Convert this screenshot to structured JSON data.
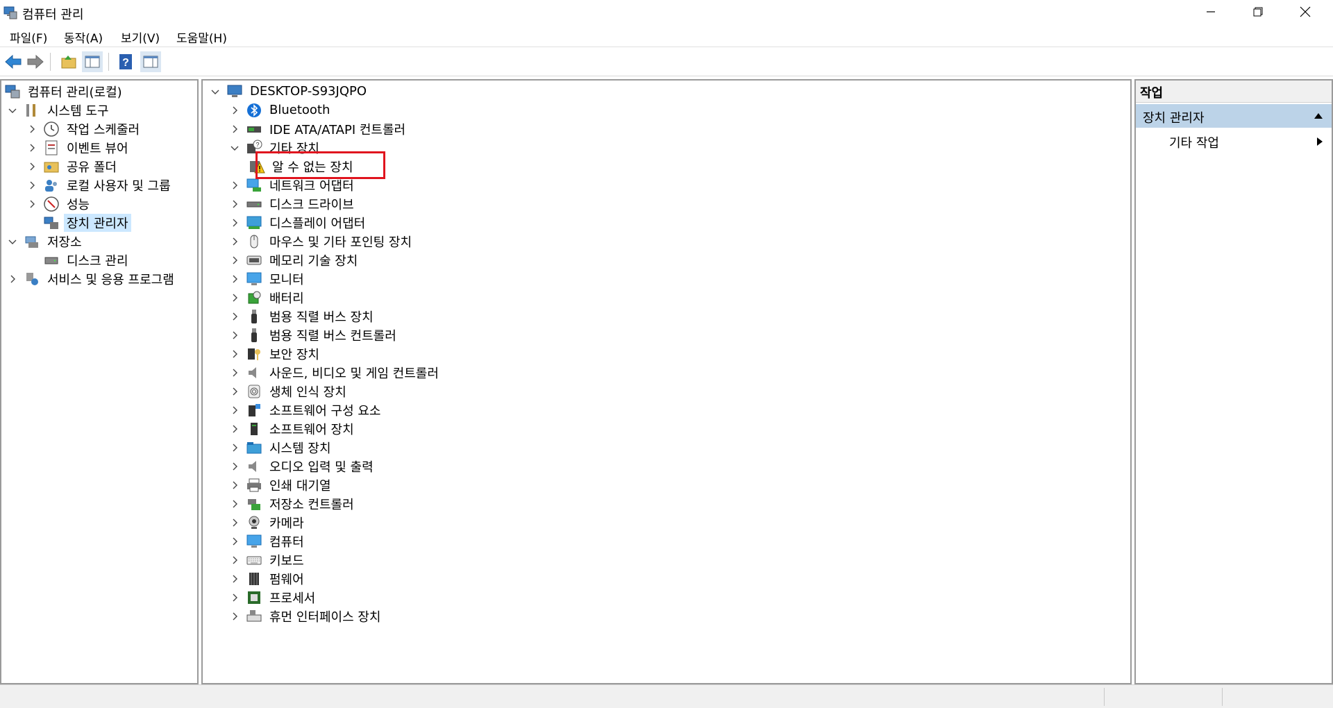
{
  "window": {
    "title": "컴퓨터 관리"
  },
  "menu": [
    {
      "label": "파일(F)"
    },
    {
      "label": "동작(A)"
    },
    {
      "label": "보기(V)"
    },
    {
      "label": "도움말(H)"
    }
  ],
  "left_tree": [
    {
      "label": "컴퓨터 관리(로컬)",
      "icon": "computer-management-icon",
      "chevron": "",
      "level": 0
    },
    {
      "label": "시스템 도구",
      "icon": "system-tools-icon",
      "chevron": "down",
      "level": 1
    },
    {
      "label": "작업 스케줄러",
      "icon": "clock-icon",
      "chevron": "right",
      "level": 2
    },
    {
      "label": "이벤트 뷰어",
      "icon": "event-viewer-icon",
      "chevron": "right",
      "level": 2
    },
    {
      "label": "공유 폴더",
      "icon": "shared-folder-icon",
      "chevron": "right",
      "level": 2
    },
    {
      "label": "로컬 사용자 및 그룹",
      "icon": "users-icon",
      "chevron": "right",
      "level": 2
    },
    {
      "label": "성능",
      "icon": "performance-icon",
      "chevron": "right",
      "level": 2
    },
    {
      "label": "장치 관리자",
      "icon": "device-manager-icon",
      "chevron": "",
      "level": 2,
      "selected": true
    },
    {
      "label": "저장소",
      "icon": "storage-icon",
      "chevron": "down",
      "level": 1
    },
    {
      "label": "디스크 관리",
      "icon": "disk-icon",
      "chevron": "",
      "level": 2
    },
    {
      "label": "서비스 및 응용 프로그램",
      "icon": "services-icon",
      "chevron": "right",
      "level": 1
    }
  ],
  "device_tree": {
    "root": {
      "label": "DESKTOP-S93JQPO",
      "icon": "computer-icon"
    },
    "items": [
      {
        "label": "Bluetooth",
        "icon": "bluetooth-icon",
        "chevron": "right",
        "level": 1
      },
      {
        "label": "IDE ATA/ATAPI 컨트롤러",
        "icon": "ide-controller-icon",
        "chevron": "right",
        "level": 1
      },
      {
        "label": "기타 장치",
        "icon": "unknown-device-category-icon",
        "chevron": "down",
        "level": 1
      },
      {
        "label": "알 수 없는 장치",
        "icon": "warning-device-icon",
        "chevron": "",
        "level": 2
      },
      {
        "label": "네트워크 어댑터",
        "icon": "network-adapter-icon",
        "chevron": "right",
        "level": 1
      },
      {
        "label": "디스크 드라이브",
        "icon": "disk-drive-icon",
        "chevron": "right",
        "level": 1
      },
      {
        "label": "디스플레이 어댑터",
        "icon": "display-adapter-icon",
        "chevron": "right",
        "level": 1
      },
      {
        "label": "마우스 및 기타 포인팅 장치",
        "icon": "mouse-icon",
        "chevron": "right",
        "level": 1
      },
      {
        "label": "메모리 기술 장치",
        "icon": "memory-device-icon",
        "chevron": "right",
        "level": 1
      },
      {
        "label": "모니터",
        "icon": "monitor-icon",
        "chevron": "right",
        "level": 1
      },
      {
        "label": "배터리",
        "icon": "battery-icon",
        "chevron": "right",
        "level": 1
      },
      {
        "label": "범용 직렬 버스 장치",
        "icon": "usb-device-icon",
        "chevron": "right",
        "level": 1
      },
      {
        "label": "범용 직렬 버스 컨트롤러",
        "icon": "usb-controller-icon",
        "chevron": "right",
        "level": 1
      },
      {
        "label": "보안 장치",
        "icon": "security-device-icon",
        "chevron": "right",
        "level": 1
      },
      {
        "label": "사운드, 비디오 및 게임 컨트롤러",
        "icon": "speaker-icon",
        "chevron": "right",
        "level": 1
      },
      {
        "label": "생체 인식 장치",
        "icon": "fingerprint-icon",
        "chevron": "right",
        "level": 1
      },
      {
        "label": "소프트웨어 구성 요소",
        "icon": "software-component-icon",
        "chevron": "right",
        "level": 1
      },
      {
        "label": "소프트웨어 장치",
        "icon": "software-device-icon",
        "chevron": "right",
        "level": 1
      },
      {
        "label": "시스템 장치",
        "icon": "system-device-icon",
        "chevron": "right",
        "level": 1
      },
      {
        "label": "오디오 입력 및 출력",
        "icon": "audio-io-icon",
        "chevron": "right",
        "level": 1
      },
      {
        "label": "인쇄 대기열",
        "icon": "printer-icon",
        "chevron": "right",
        "level": 1
      },
      {
        "label": "저장소 컨트롤러",
        "icon": "storage-controller-icon",
        "chevron": "right",
        "level": 1
      },
      {
        "label": "카메라",
        "icon": "camera-icon",
        "chevron": "right",
        "level": 1
      },
      {
        "label": "컴퓨터",
        "icon": "computer-monitor-icon",
        "chevron": "right",
        "level": 1
      },
      {
        "label": "키보드",
        "icon": "keyboard-icon",
        "chevron": "right",
        "level": 1
      },
      {
        "label": "펌웨어",
        "icon": "firmware-icon",
        "chevron": "right",
        "level": 1
      },
      {
        "label": "프로세서",
        "icon": "processor-icon",
        "chevron": "right",
        "level": 1
      },
      {
        "label": "휴먼 인터페이스 장치",
        "icon": "hid-icon",
        "chevron": "right",
        "level": 1
      }
    ]
  },
  "actions": {
    "header": "작업",
    "section": "장치 관리자",
    "item": "기타 작업"
  }
}
